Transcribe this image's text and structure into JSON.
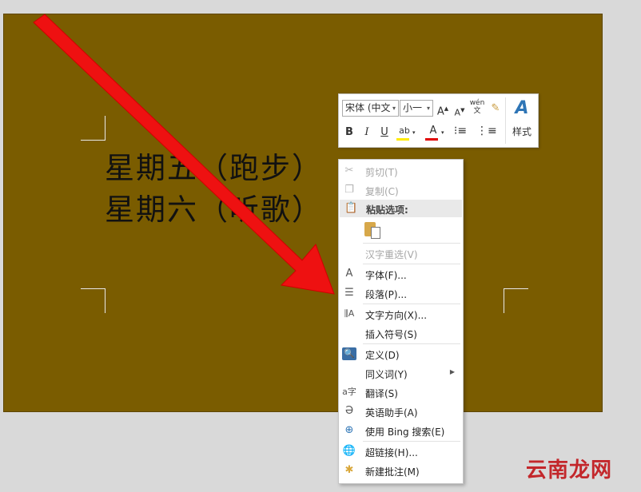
{
  "document": {
    "lines": [
      "星期五（跑步）",
      "星期六（听歌）"
    ],
    "background_color": "#7a5c00"
  },
  "mini_toolbar": {
    "font_name": "宋体 (中文",
    "font_size": "小一",
    "grow_font": "A",
    "shrink_font": "A",
    "phonetic": "wén\n文",
    "bold": "B",
    "italic": "I",
    "underline": "U",
    "font_color": "A",
    "styles_glyph": "A",
    "styles_label": "样式"
  },
  "context_menu": {
    "cut": "剪切(T)",
    "copy": "复制(C)",
    "paste_options": "粘贴选项:",
    "reconvert": "汉字重选(V)",
    "font": "字体(F)...",
    "paragraph": "段落(P)...",
    "text_direction": "文字方向(X)...",
    "insert_symbol": "插入符号(S)",
    "define": "定义(D)",
    "synonyms": "同义词(Y)",
    "translate": "翻译(S)",
    "english_assistant": "英语助手(A)",
    "bing_search": "使用 Bing 搜索(E)",
    "hyperlink": "超链接(H)...",
    "new_comment": "新建批注(M)"
  },
  "watermark": "云南龙网",
  "icons": [
    "scissors-icon",
    "copy-icon",
    "paste-icon",
    "paste-keep-text-icon",
    "font-icon",
    "paragraph-icon",
    "text-direction-icon",
    "define-icon",
    "translate-icon",
    "english-assistant-icon",
    "bing-search-icon",
    "hyperlink-icon",
    "new-comment-icon",
    "red-arrow"
  ]
}
